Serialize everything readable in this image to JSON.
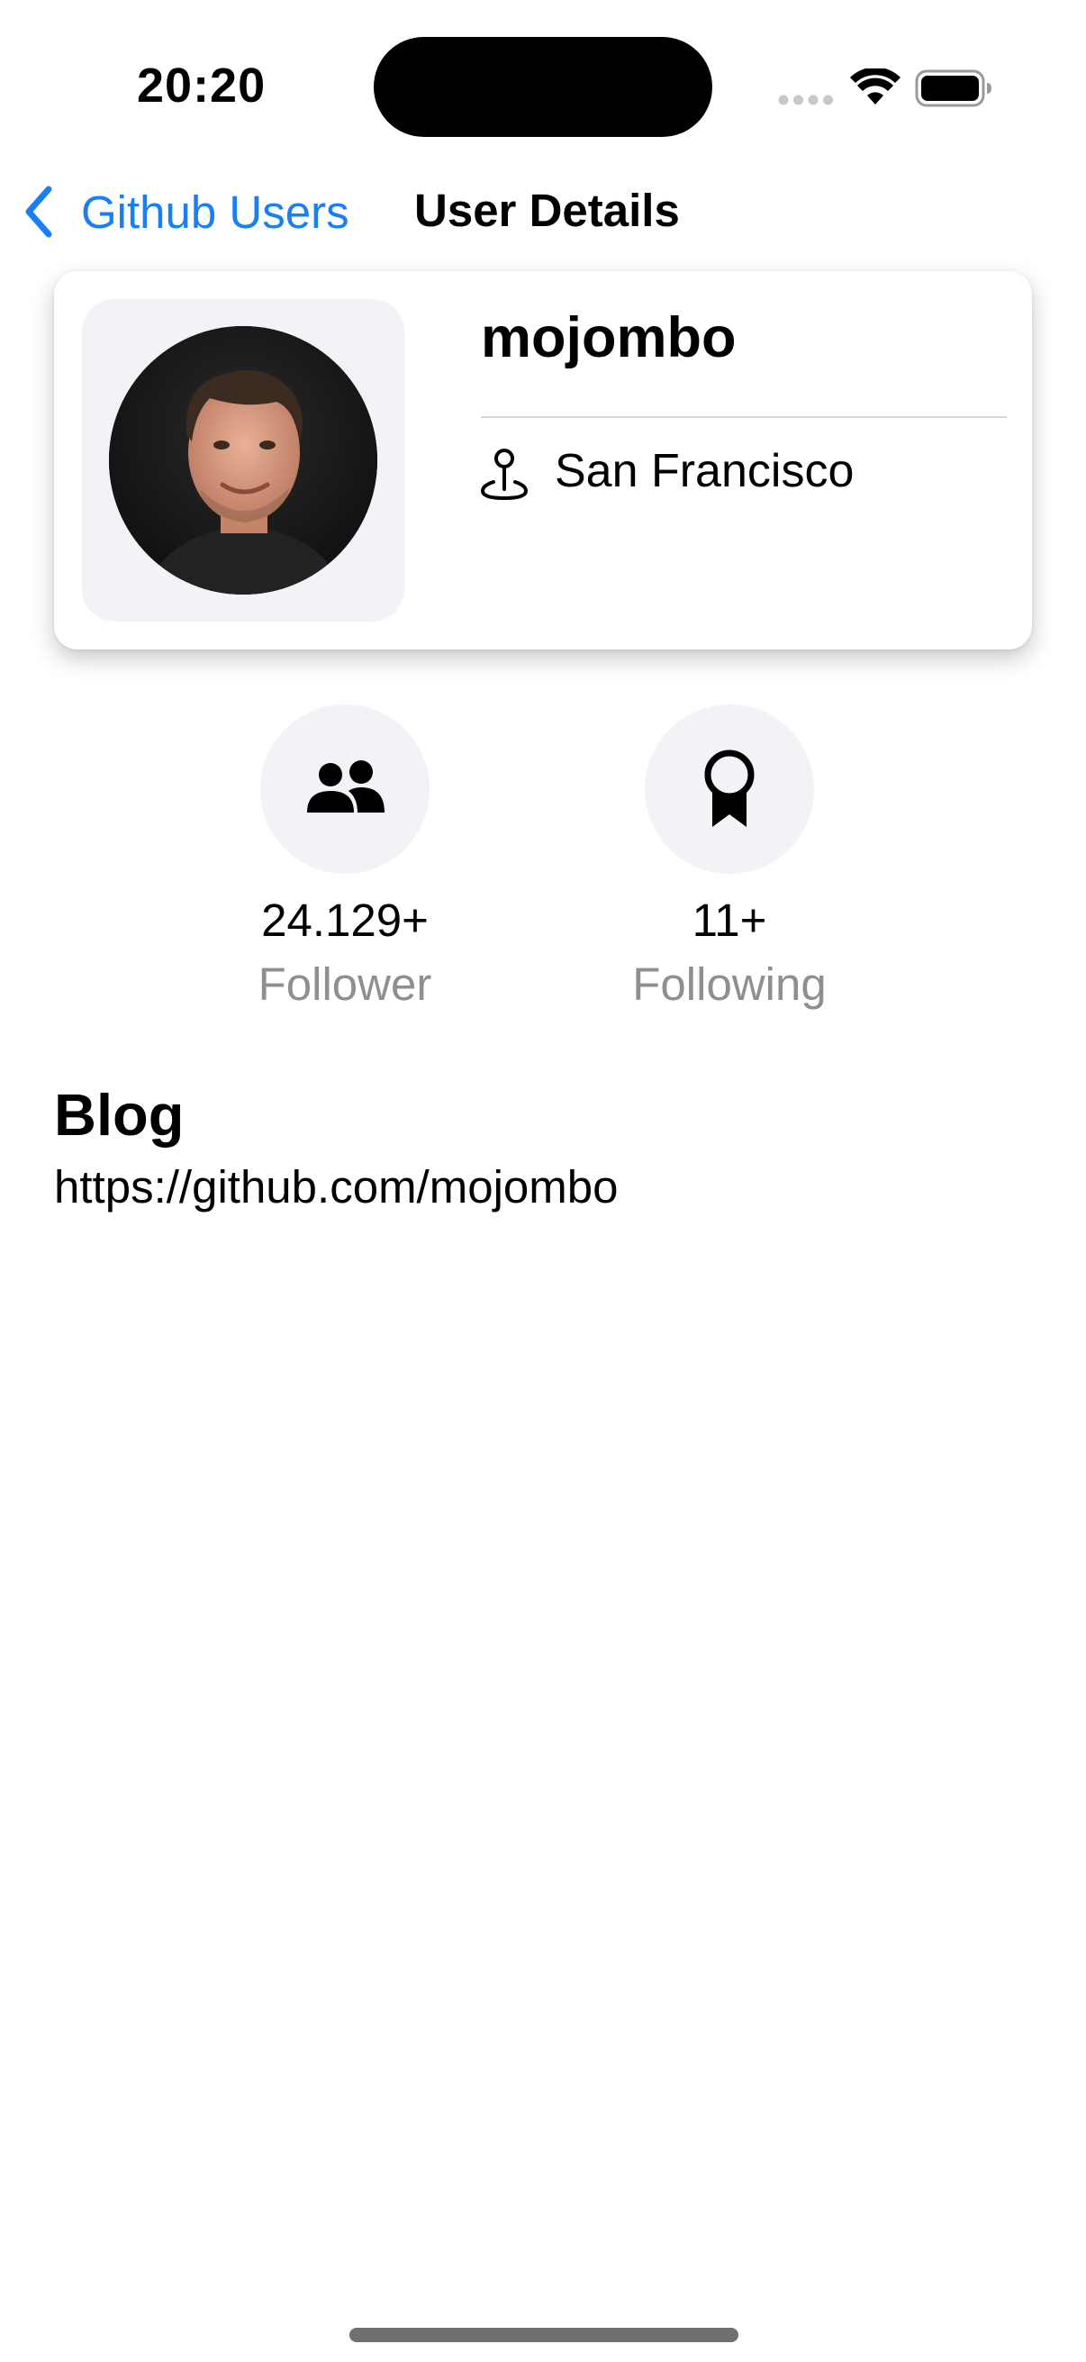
{
  "status_bar": {
    "time": "20:20",
    "icons": [
      "signal-dots-icon",
      "wifi-icon",
      "battery-icon"
    ]
  },
  "nav": {
    "back_label": "Github Users",
    "title": "User Details",
    "back_icon": "chevron-left-icon",
    "accent_color": "#1a7ef5"
  },
  "profile": {
    "username": "mojombo",
    "location": "San Francisco",
    "location_icon": "map-pin-icon",
    "avatar": "avatar-photo"
  },
  "stats": [
    {
      "value": "24.129+",
      "label": "Follower",
      "icon": "people-icon"
    },
    {
      "value": "11+",
      "label": "Following",
      "icon": "award-ribbon-icon"
    }
  ],
  "blog": {
    "heading": "Blog",
    "url": "https://github.com/mojombo"
  }
}
